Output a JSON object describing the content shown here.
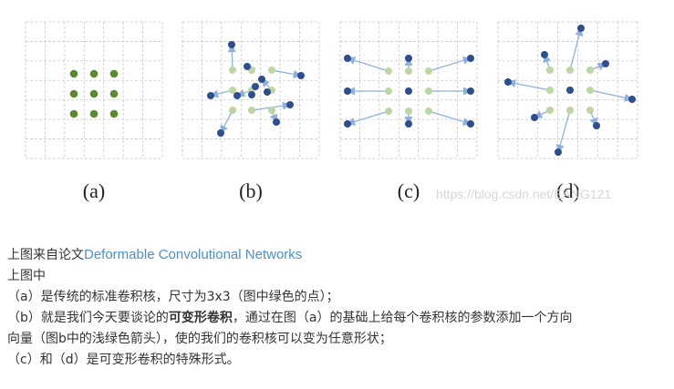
{
  "figure": {
    "captions": [
      "(a)",
      "(b)",
      "(c)",
      "(d)"
    ],
    "watermark": "https://blog.csdn.net/EANG121",
    "colors": {
      "green_dot": "#5a8a2e",
      "light_green_dot": "#bcd7a3",
      "blue_dot": "#2e4f8f",
      "arrow": "#8fb0da",
      "grid": "#c9c9c9"
    }
  },
  "article": {
    "line1_prefix": "上图来自论文",
    "line1_link": "Deformable Convolutional Networks",
    "line2": "上图中",
    "line3": "（a）是传统的标准卷积核，尺寸为3x3（图中绿色的点）；",
    "line4_prefix": "（b）就是我们今天要谈论的",
    "line4_bold": "可变形卷积",
    "line4_suffix": "，通过在图（a）的基础上给每个卷积核的参数添加一个方向",
    "line5": "向量（图b中的浅绿色箭头），使的我们的卷积核可以变为任意形状；",
    "line6": "（c）和（d）是可变形卷积的特殊形式。"
  }
}
